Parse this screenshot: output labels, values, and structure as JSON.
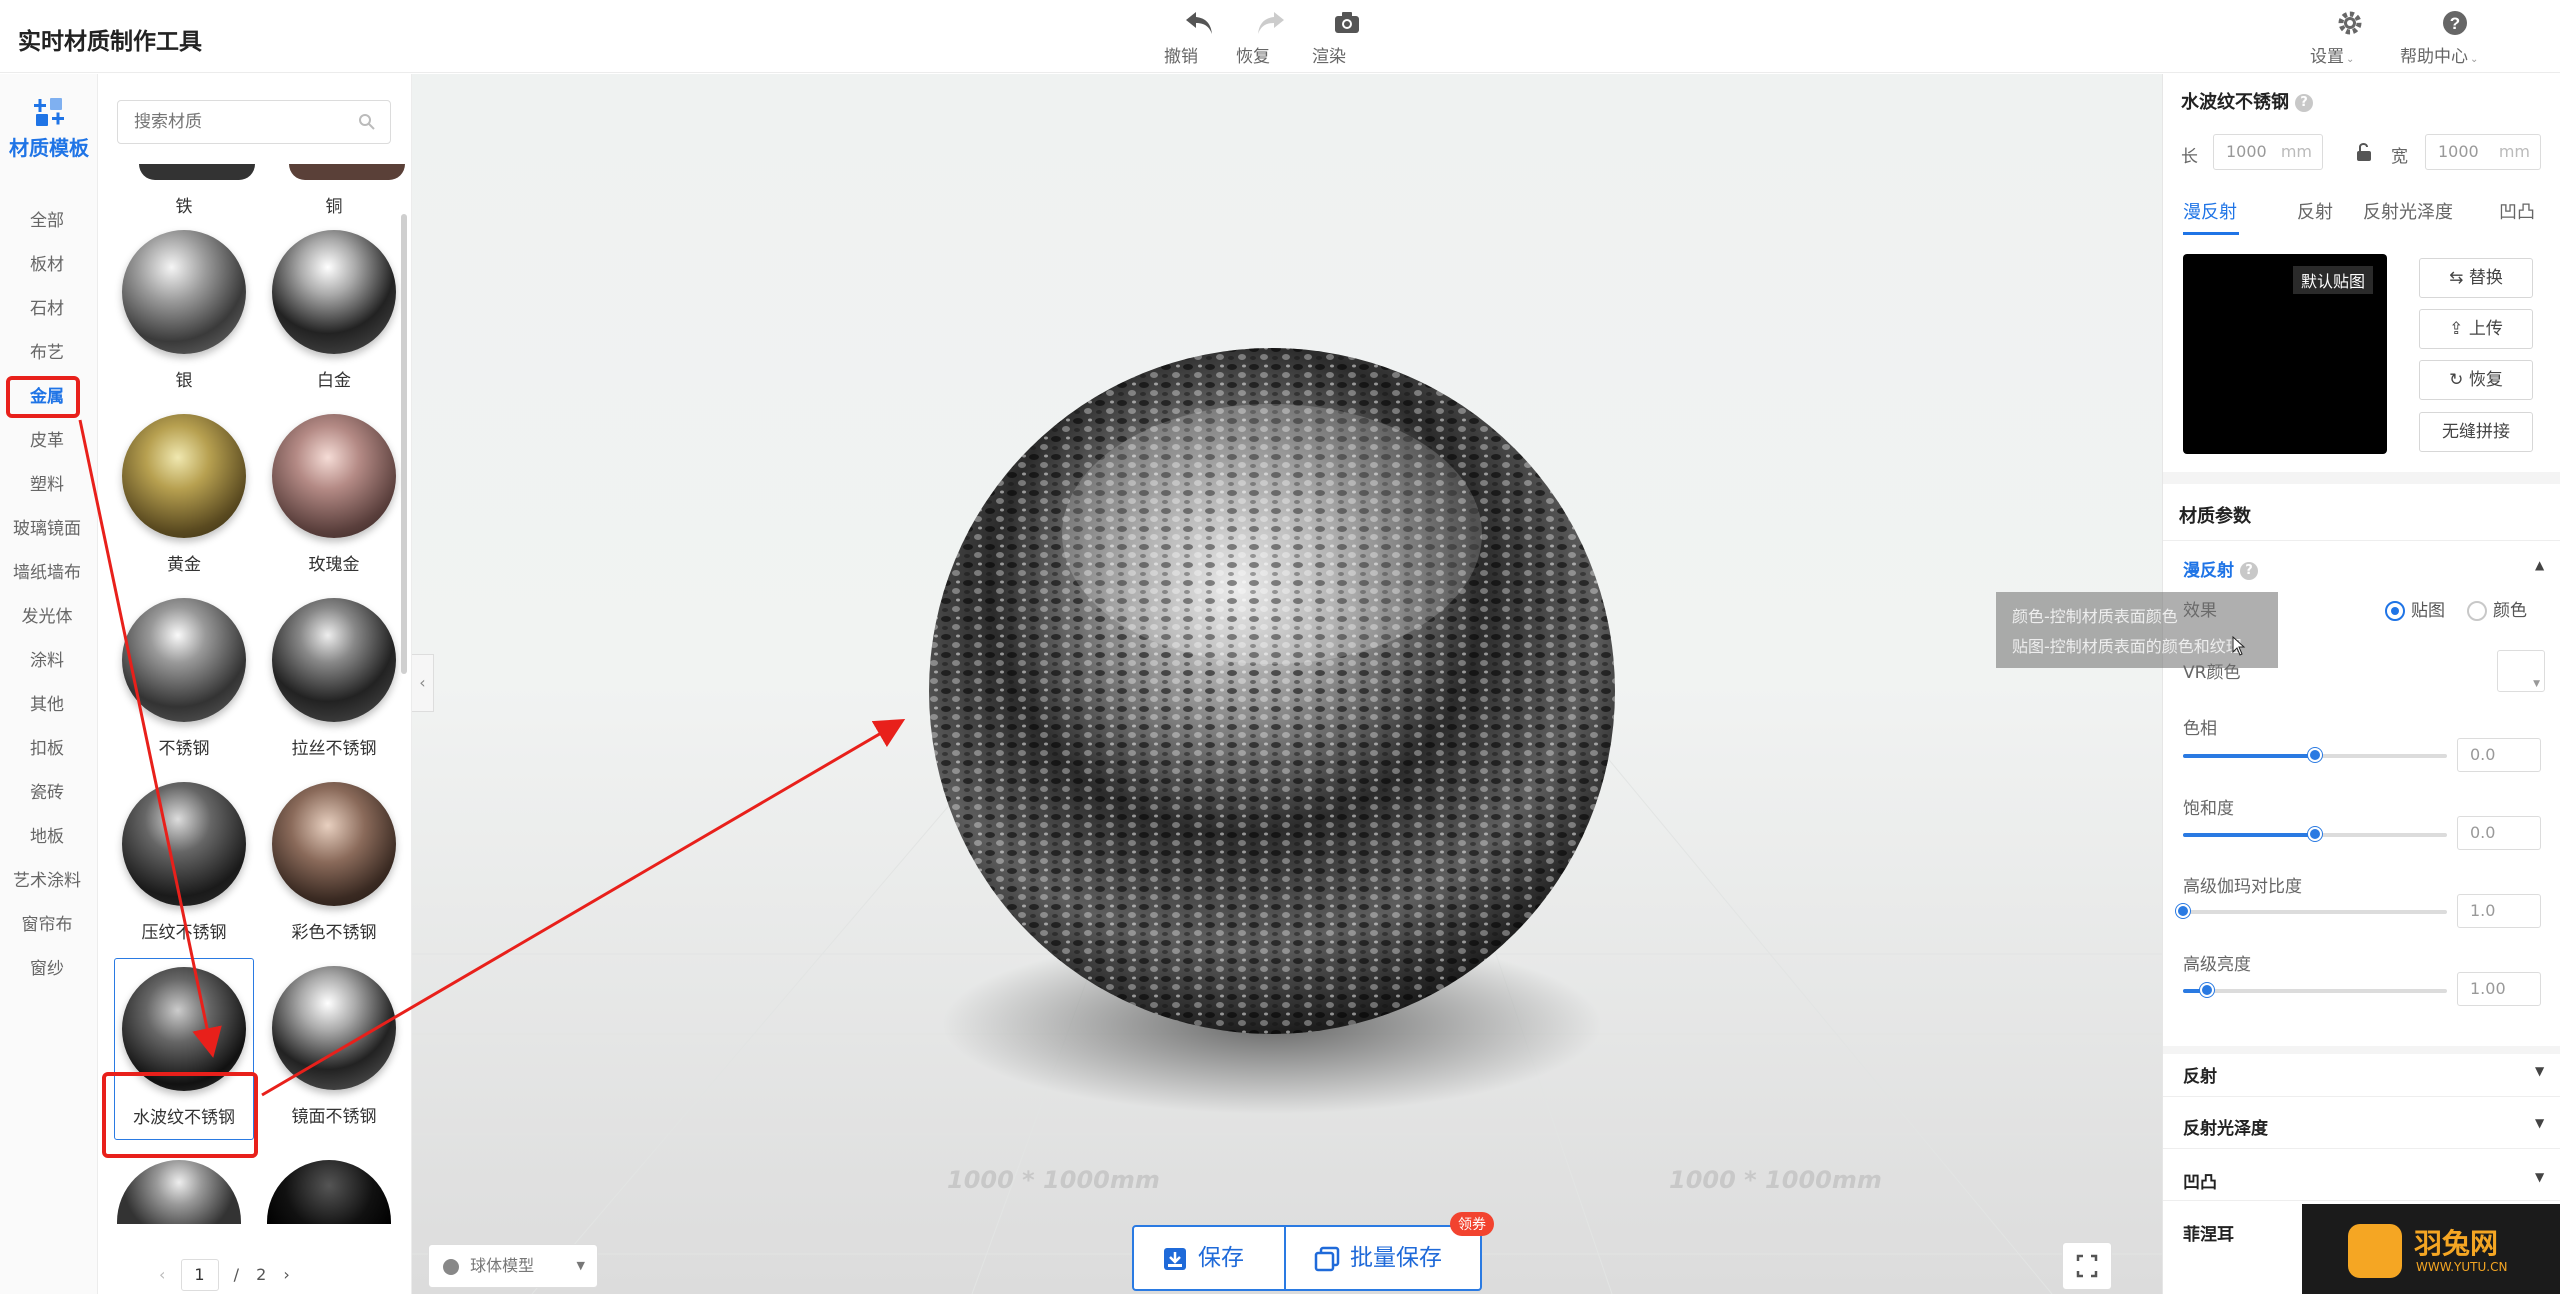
{
  "app": {
    "title": "实时材质制作工具"
  },
  "toolbar": {
    "undo": "撤销",
    "redo": "恢复",
    "render": "渲染",
    "settings": "设置",
    "help": "帮助中心"
  },
  "rail": {
    "header": "材质模板",
    "categories": [
      "全部",
      "板材",
      "石材",
      "布艺",
      "金属",
      "皮革",
      "塑料",
      "玻璃镜面",
      "墙纸墙布",
      "发光体",
      "涂料",
      "其他",
      "扣板",
      "瓷砖",
      "地板",
      "艺术涂料",
      "窗帘布",
      "窗纱"
    ],
    "active": "金属"
  },
  "materials": {
    "search_placeholder": "搜索材质",
    "items": [
      {
        "name": "铁"
      },
      {
        "name": "铜"
      },
      {
        "name": "银"
      },
      {
        "name": "白金"
      },
      {
        "name": "黄金"
      },
      {
        "name": "玫瑰金"
      },
      {
        "name": "不锈钢"
      },
      {
        "name": "拉丝不锈钢"
      },
      {
        "name": "压纹不锈钢"
      },
      {
        "name": "彩色不锈钢"
      },
      {
        "name": "水波纹不锈钢"
      },
      {
        "name": "镜面不锈钢"
      }
    ],
    "selected": "水波纹不锈钢",
    "pager": {
      "current": "1",
      "separator": "/",
      "total": "2"
    }
  },
  "viewport": {
    "model": "球体模型",
    "dimension_label": "1000 * 1000mm",
    "save": "保存",
    "batch_save": "批量保存",
    "coupon": "领券"
  },
  "panel": {
    "material_name": "水波纹不锈钢",
    "size": {
      "length_label": "长",
      "length": "1000",
      "width_label": "宽",
      "width": "1000",
      "unit": "mm"
    },
    "tabs": [
      "漫反射",
      "反射",
      "反射光泽度",
      "凹凸"
    ],
    "texture_tag": "默认贴图",
    "buttons": {
      "replace": "替换",
      "upload": "上传",
      "restore": "恢复",
      "seamless": "无缝拼接"
    },
    "params_title": "材质参数",
    "diffuse": {
      "title": "漫反射",
      "effect_label": "效果",
      "option_texture": "贴图",
      "option_color": "颜色",
      "vr_color": "VR颜色",
      "hue_label": "色相",
      "hue": "0.0",
      "hue_pos": 0.5,
      "sat_label": "饱和度",
      "sat": "0.0",
      "sat_pos": 0.5,
      "gamma_label": "高级伽玛对比度",
      "gamma": "1.0",
      "gamma_pos": 0.0,
      "bright_label": "高级亮度",
      "bright": "1.00",
      "bright_pos": 0.09
    },
    "sections": [
      "反射",
      "反射光泽度",
      "凹凸",
      "菲涅耳"
    ],
    "tooltip": [
      "颜色-控制材质表面颜色",
      "贴图-控制材质表面的颜色和纹理"
    ]
  },
  "watermark": {
    "name": "羽兔网",
    "url": "WWW.YUTU.CN"
  }
}
